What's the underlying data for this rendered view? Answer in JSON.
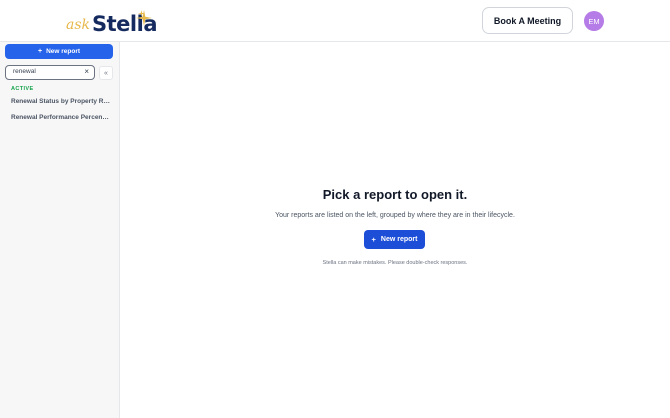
{
  "header": {
    "logo": {
      "prefix": "ask",
      "name": "Stella"
    },
    "book_meeting_label": "Book A Meeting",
    "avatar_initials": "EM"
  },
  "sidebar": {
    "new_report_label": "New report",
    "new_report_icon": "plus-icon",
    "search": {
      "value": "renewal",
      "clear_icon": "close-icon"
    },
    "collapse_icon": "chevrons-left-icon",
    "collapse_glyph": "«",
    "section_label": "ACTIVE",
    "items": [
      {
        "label": "Renewal Status by Property Report"
      },
      {
        "label": "Renewal Performance Percentage Report"
      }
    ]
  },
  "main": {
    "title": "Pick a report to open it.",
    "subtitle": "Your reports are listed on the left, grouped by where they are in their lifecycle.",
    "new_report_label": "New report",
    "disclaimer": "Stella can make mistakes. Please double-check responses."
  },
  "colors": {
    "primary": "#2563eb",
    "logo_navy": "#152a5e",
    "logo_gold": "#e7b84a",
    "active_green": "#16a34a",
    "avatar": "#b57be6"
  }
}
